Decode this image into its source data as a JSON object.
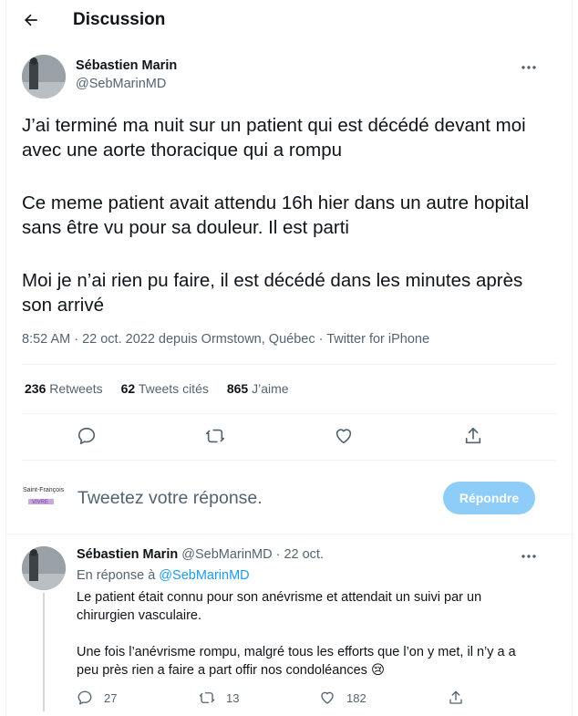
{
  "header": {
    "title": "Discussion"
  },
  "tweet": {
    "author_name": "Sébastien Marin",
    "author_handle": "@SebMarinMD",
    "paragraphs": [
      "J’ai terminé ma nuit sur un patient qui est décédé devant moi avec une aorte thoracique qui a rompu",
      "Ce meme patient avait attendu 16h hier dans un autre hopital sans être vu pour sa douleur. Il est parti",
      "Moi je n’ai rien pu faire, il est décédé dans les minutes après son arrivé"
    ],
    "meta": "8:52 AM · 22 oct. 2022 depuis Ormstown, Québec · Twitter for iPhone",
    "stats": {
      "retweets_count": "236",
      "retweets_label": "Retweets",
      "quotes_count": "62",
      "quotes_label": "Tweets cités",
      "likes_count": "865",
      "likes_label": "J’aime"
    },
    "icons": [
      "reply-icon",
      "retweet-icon",
      "like-icon",
      "share-icon"
    ]
  },
  "compose": {
    "placeholder": "Tweetez votre réponse.",
    "button_label": "Répondre",
    "button_color": "#8ecdf8",
    "brand_text_1": "Saint-François",
    "brand_text_2": "VIVRE"
  },
  "reply": {
    "author_name": "Sébastien Marin",
    "author_handle": "@SebMarinMD",
    "date": "· 22 oct.",
    "reply_to_prefix": "En réponse à",
    "reply_to_handle": "@SebMarinMD",
    "line1": "Le patient était connu pour son anévrisme et attendait un suivi par un",
    "line2": "chirurgien vasculaire.",
    "line3": "Une fois l’anévrisme rompu, malgré tous les efforts que l’on y met, il n’y a a",
    "line4": "peu près rien a faire a part offir nos condoléances 😢",
    "reply_count": "27",
    "retweet_count": "13",
    "like_count": "182"
  },
  "colors": {
    "accent": "#1d9bf0",
    "muted": "#536471",
    "text": "#0f1419"
  }
}
